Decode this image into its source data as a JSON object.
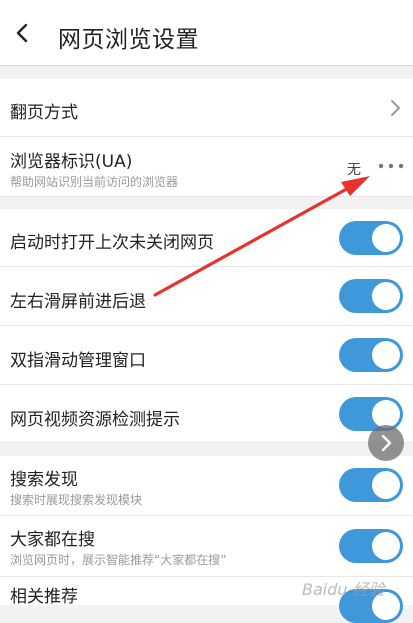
{
  "header": {
    "title": "网页浏览设置",
    "back_icon": "chevron-left-icon"
  },
  "rows": [
    {
      "label": "翻页方式"
    },
    {
      "label": "浏览器标识(UA)",
      "sub": "帮助网站识别当前访问的浏览器",
      "value": "无"
    },
    {
      "label": "启动时打开上次未关闭网页",
      "toggle": true
    },
    {
      "label": "左右滑屏前进后退",
      "toggle": true
    },
    {
      "label": "双指滑动管理窗口",
      "toggle": true
    },
    {
      "label": "网页视频资源检测提示",
      "toggle": true
    },
    {
      "label": "搜索发现",
      "sub": "搜索时展现搜索发现模块",
      "toggle": true
    },
    {
      "label": "大家都在搜",
      "sub": "浏览网页时，展示智能推荐“大家都在搜”",
      "toggle": true
    },
    {
      "label": "相关推荐",
      "toggle": true
    }
  ],
  "watermark": "Baidu 经验",
  "colors": {
    "accent": "#3f98d9",
    "annotation_arrow": "#e8322d"
  }
}
